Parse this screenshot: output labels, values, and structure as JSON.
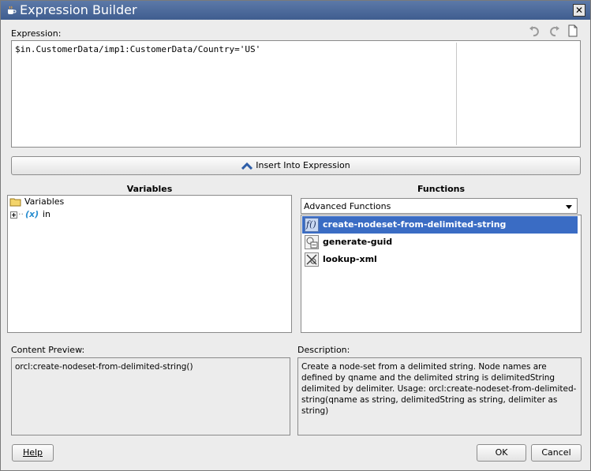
{
  "window": {
    "title": "Expression Builder",
    "close_glyph": "✕"
  },
  "expression": {
    "label": "Expression:",
    "value": "$in.CustomerData/imp1:CustomerData/Country='US'"
  },
  "toolbar": {
    "icons": [
      "undo-icon",
      "redo-icon",
      "new-document-icon"
    ]
  },
  "insert_button": {
    "label": "Insert Into Expression"
  },
  "variables": {
    "title": "Variables",
    "tree": [
      {
        "label": "Variables",
        "icon": "folder-icon"
      },
      {
        "label": "in",
        "icon": "variable-x-icon",
        "symbol": "(x)"
      }
    ]
  },
  "functions": {
    "title": "Functions",
    "category": "Advanced Functions",
    "items": [
      {
        "label": "create-nodeset-from-delimited-string",
        "selected": true,
        "icon": "function-fx-icon"
      },
      {
        "label": "generate-guid",
        "selected": false,
        "icon": "guid-icon"
      },
      {
        "label": "lookup-xml",
        "selected": false,
        "icon": "xml-lookup-icon"
      }
    ]
  },
  "content_preview": {
    "label": "Content Preview:",
    "text": "orcl:create-nodeset-from-delimited-string()"
  },
  "description": {
    "label": "Description:",
    "text": "Create a node-set from a delimited string. Node names are defined by qname and the delimited string is delimitedString delimited by delimiter. Usage: orcl:create-nodeset-from-delimited-string(qname as string, delimitedString as string, delimiter as string)"
  },
  "buttons": {
    "help": "Help",
    "ok": "OK",
    "cancel": "Cancel"
  },
  "colors": {
    "selection": "#3A6CC4",
    "titlebar": "#3F5D8F",
    "insert_caret": "#2E5EA8"
  }
}
